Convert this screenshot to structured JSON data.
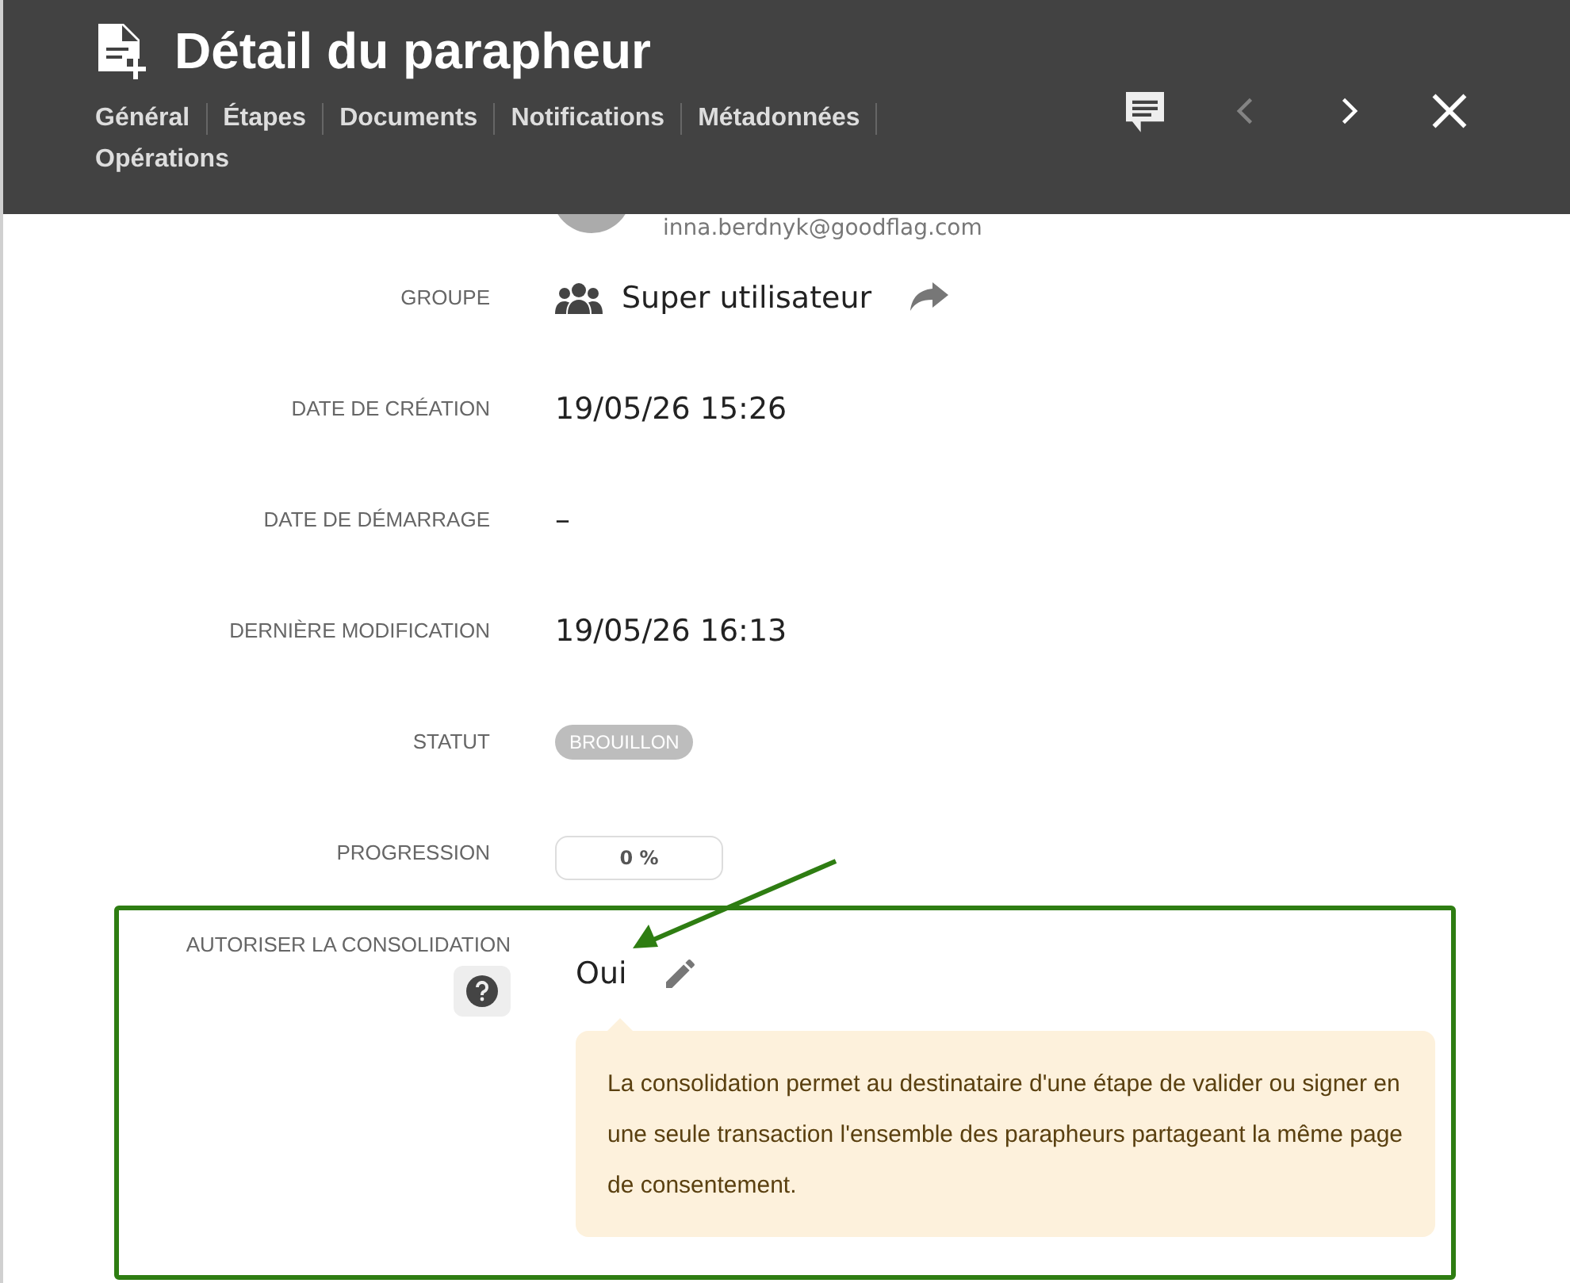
{
  "header": {
    "title": "Détail du parapheur",
    "tabs": [
      {
        "label": "Général"
      },
      {
        "label": "Étapes"
      },
      {
        "label": "Documents"
      },
      {
        "label": "Notifications"
      },
      {
        "label": "Métadonnées"
      },
      {
        "label": "Opérations"
      }
    ],
    "actions": [
      {
        "kind": "comment",
        "disabled": false
      },
      {
        "kind": "prev",
        "disabled": true
      },
      {
        "kind": "next",
        "disabled": false
      },
      {
        "kind": "close",
        "disabled": false
      }
    ]
  },
  "owner": {
    "email": "inna.berdnyk@goodflag.com"
  },
  "fields": [
    {
      "kind": "group",
      "label": "GROUPE",
      "value": "Super utilisateur"
    },
    {
      "kind": "text",
      "label": "DATE DE CRÉATION",
      "value": "19/05/26 15:26"
    },
    {
      "kind": "text",
      "label": "DATE DE DÉMARRAGE",
      "value": "–"
    },
    {
      "kind": "text",
      "label": "DERNIÈRE MODIFICATION",
      "value": "19/05/26 16:13"
    },
    {
      "kind": "badge",
      "label": "STATUT",
      "value": "BROUILLON"
    },
    {
      "kind": "progress",
      "label": "PROGRESSION",
      "value": "0 %",
      "level": 0
    }
  ],
  "consolidation": {
    "label": "AUTORISER LA CONSOLIDATION",
    "value": "Oui",
    "highlighted": true,
    "help": "La consolidation permet au destinataire d'une étape de valider ou signer en une seule transaction l'ensemble des parapheurs partageant la même page de consentement."
  }
}
